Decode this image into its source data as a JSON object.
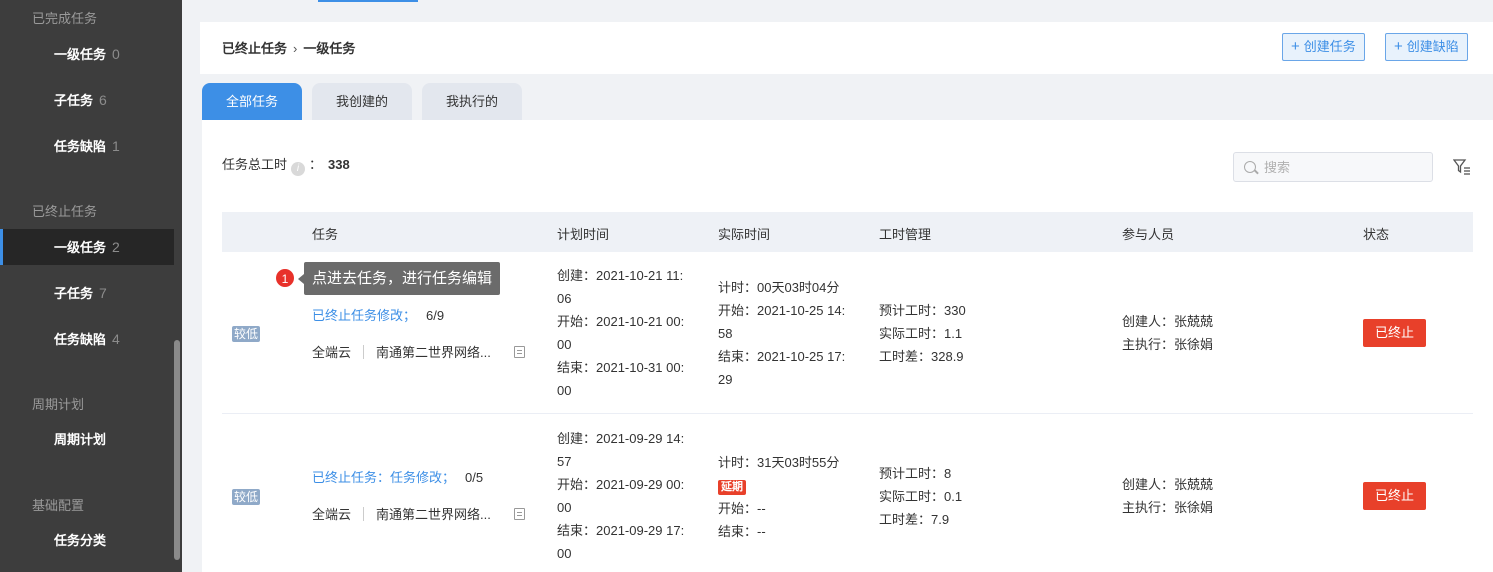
{
  "sidebar": {
    "groups": [
      {
        "label": "已完成任务",
        "items": [
          {
            "label": "一级任务",
            "count": "0"
          },
          {
            "label": "子任务",
            "count": "6"
          },
          {
            "label": "任务缺陷",
            "count": "1"
          }
        ]
      },
      {
        "label": "已终止任务",
        "items": [
          {
            "label": "一级任务",
            "count": "2",
            "active": true
          },
          {
            "label": "子任务",
            "count": "7"
          },
          {
            "label": "任务缺陷",
            "count": "4"
          }
        ]
      },
      {
        "label": "周期计划",
        "items": [
          {
            "label": "周期计划",
            "count": ""
          }
        ]
      },
      {
        "label": "基础配置",
        "items": [
          {
            "label": "任务分类",
            "count": ""
          }
        ]
      }
    ]
  },
  "header": {
    "breadcrumb": [
      "已终止任务",
      "一级任务"
    ],
    "breadcrumb_sep": "›",
    "create_task": "创建任务",
    "create_defect": "创建缺陷"
  },
  "tabs": [
    "全部任务",
    "我创建的",
    "我执行的"
  ],
  "summary": {
    "label": "任务总工时",
    "colon": "：",
    "value": "338"
  },
  "search": {
    "placeholder": "搜索"
  },
  "table": {
    "columns": [
      "任务",
      "计划时间",
      "实际时间",
      "工时管理",
      "参与人员",
      "状态"
    ],
    "rows": [
      {
        "priority": "较低",
        "task_name": "已终止任务修改；",
        "task_count": "6/9",
        "project": "全端云",
        "project_detail": "南通第二世界网络...",
        "plan": [
          "创建：2021-10-21 11:",
          "06",
          "开始：2021-10-21 00:",
          "00",
          "结束：2021-10-31 00:",
          "00"
        ],
        "actual": [
          "计时：00天03时04分",
          "开始：2021-10-25 14:",
          "58",
          "结束：2021-10-25 17:",
          "29"
        ],
        "hours": [
          "预计工时：330",
          "实际工时：1.1",
          "工时差：328.9"
        ],
        "people": [
          "创建人：张兢兢",
          "主执行：张徐娟"
        ],
        "status": "已终止"
      },
      {
        "priority": "较低",
        "task_name": "已终止任务：任务修改；",
        "task_count": "0/5",
        "project": "全端云",
        "project_detail": "南通第二世界网络...",
        "plan": [
          "创建：2021-09-29 14:",
          "57",
          "开始：2021-09-29 00:",
          "00",
          "结束：2021-09-29 17:",
          "00"
        ],
        "actual_timer": "计时：31天03时55分",
        "delay": "延期",
        "actual_rest": [
          "开始：--",
          "结束：--"
        ],
        "hours": [
          "预计工时：8",
          "实际工时：0.1",
          "工时差：7.9"
        ],
        "people": [
          "创建人：张兢兢",
          "主执行：张徐娟"
        ],
        "status": "已终止"
      }
    ]
  },
  "tooltip": {
    "badge": "1",
    "text": "点进去任务，进行任务编辑"
  }
}
